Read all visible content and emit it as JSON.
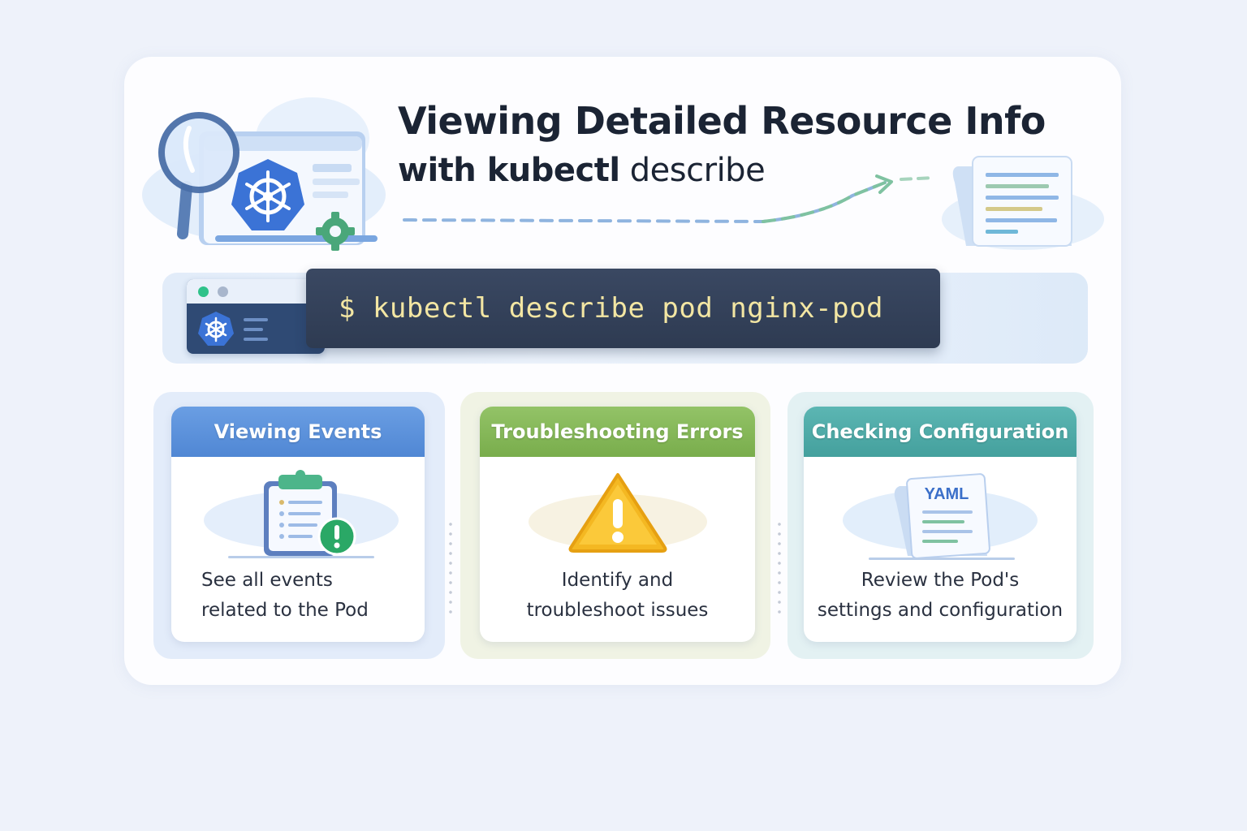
{
  "title": {
    "line1": "Viewing Detailed Resource Info",
    "line2_bold": "with kubectl",
    "line2_light": " describe"
  },
  "command": "$ kubectl describe pod nginx-pod",
  "cards": [
    {
      "heading": "Viewing Events",
      "desc_line1": "See all events",
      "desc_line2": "related to the Pod",
      "color": "#5b90db"
    },
    {
      "heading": "Troubleshooting Errors",
      "desc_line1": "Identify and",
      "desc_line2": "troubleshoot issues",
      "color": "#86b95a"
    },
    {
      "heading": "Checking Configuration",
      "desc_line1": "Review the Pod's",
      "desc_line2": "settings and configuration",
      "color": "#4ea8a6"
    }
  ],
  "yaml_label": "YAML",
  "icons": [
    "magnifier-icon",
    "kubernetes-wheel-icon",
    "gear-icon",
    "document-icon",
    "clipboard-icon",
    "alert-badge-icon",
    "warning-triangle-icon",
    "yaml-document-icon"
  ]
}
